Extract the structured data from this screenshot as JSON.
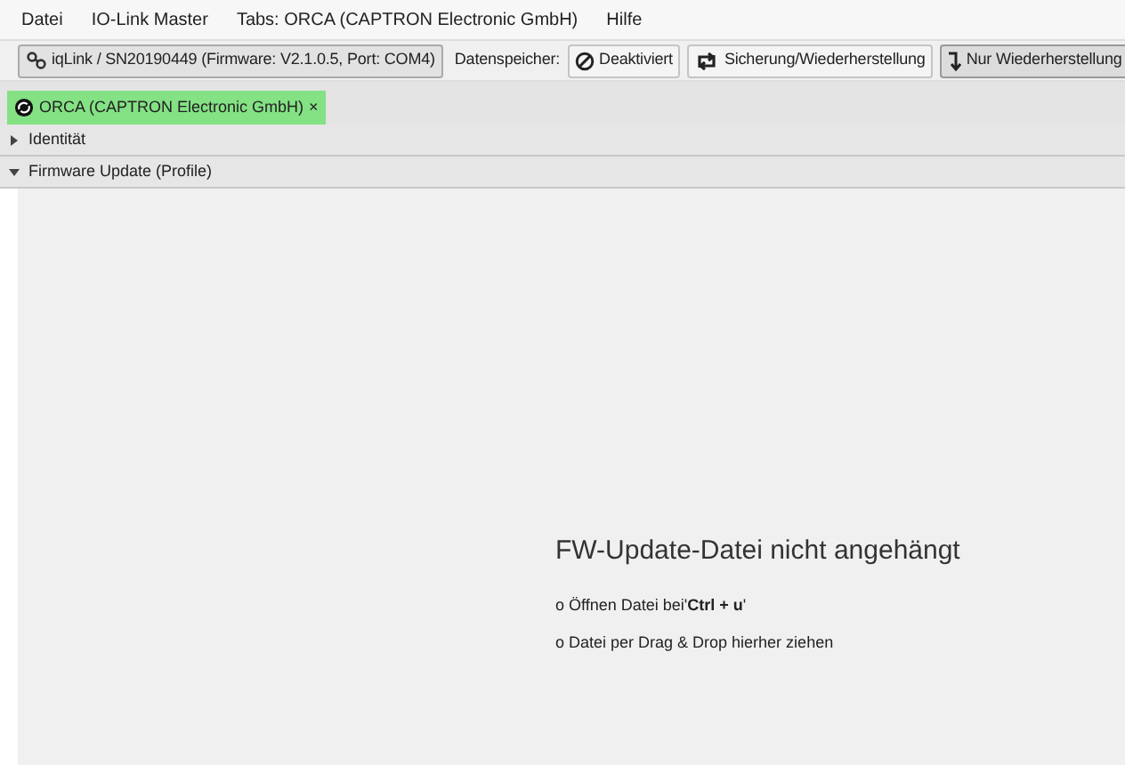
{
  "menu": [
    "Datei",
    "IO-Link Master",
    "Tabs: ORCA (CAPTRON Electronic GmbH)",
    "Hilfe"
  ],
  "toolbar": {
    "device": "iqLink / SN20190449 (Firmware: V2.1.0.5, Port: COM4)",
    "storage_label": "Datenspeicher:",
    "modes": [
      {
        "kind": "off",
        "label": "Deaktiviert",
        "selected": false
      },
      {
        "kind": "backup",
        "label": "Sicherung/Wiederherstellung",
        "selected": false
      },
      {
        "kind": "restore",
        "label": "Nur Wiederherstellung",
        "selected": true
      }
    ]
  },
  "tabs": [
    {
      "label": "ORCA (CAPTRON Electronic GmbH)",
      "close": "×",
      "selected": true
    }
  ],
  "sections": [
    {
      "title": "Identität",
      "expanded": false
    },
    {
      "title": "Firmware Update (Profile)",
      "expanded": true
    }
  ],
  "empty": {
    "title": "FW-Update-Datei nicht angehängt",
    "hints": [
      "o Öffnen Datei bei'**Ctrl + u**'",
      "o Datei per Drag & Drop hierher ziehen"
    ]
  }
}
